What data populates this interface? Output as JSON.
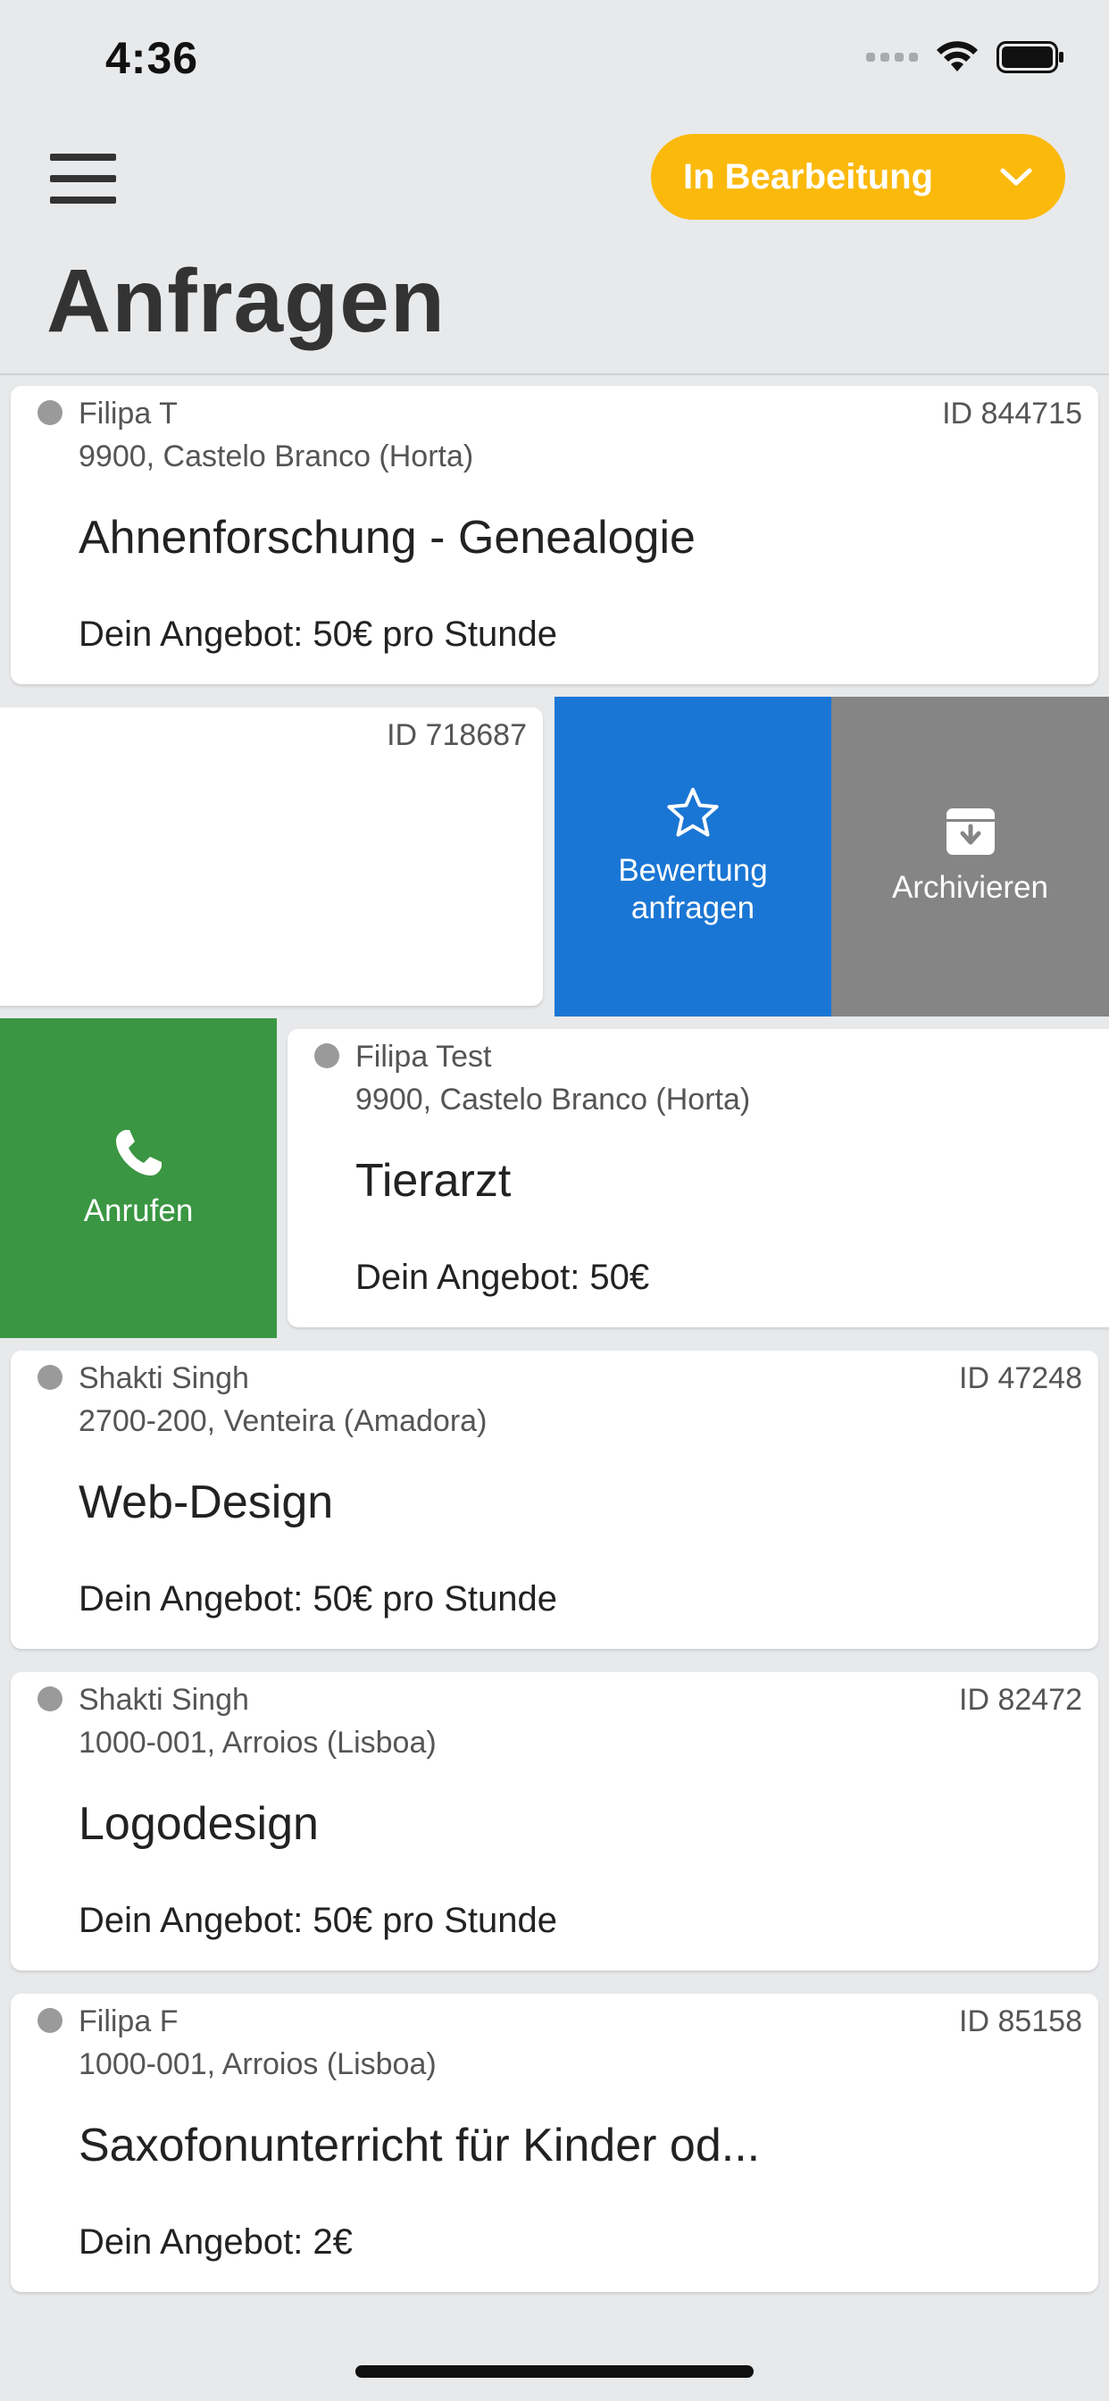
{
  "status_bar": {
    "time": "4:36"
  },
  "header": {
    "filter_label": "In Bearbeitung",
    "title": "Anfragen"
  },
  "requests": [
    {
      "name": "Filipa T",
      "location": "9900, Castelo Branco (Horta)",
      "id": "ID 844715",
      "title": "Ahnenforschung - Genealogie",
      "offer": "Dein Angebot: 50€ pro Stunde"
    },
    {
      "id": "ID 718687"
    },
    {
      "name": "Filipa Test",
      "location": "9900, Castelo Branco (Horta)",
      "title": "Tierarzt",
      "offer": "Dein Angebot: 50€"
    },
    {
      "name": "Shakti Singh",
      "location": "2700-200, Venteira (Amadora)",
      "id": "ID 47248",
      "title": "Web-Design",
      "offer": "Dein Angebot: 50€ pro Stunde"
    },
    {
      "name": "Shakti Singh",
      "location": "1000-001, Arroios (Lisboa)",
      "id": "ID 82472",
      "title": "Logodesign",
      "offer": "Dein Angebot: 50€ pro Stunde"
    },
    {
      "name": "Filipa F",
      "location": "1000-001, Arroios (Lisboa)",
      "id": "ID 85158",
      "title": "Saxofonunterricht für Kinder od...",
      "offer": "Dein Angebot: 2€"
    }
  ],
  "actions": {
    "rate": "Bewertung anfragen",
    "archive": "Archivieren",
    "call": "Anrufen"
  },
  "colors": {
    "accent_yellow": "#fbb90c",
    "rate_blue": "#1a76d4",
    "archive_gray": "#858585",
    "call_green": "#3a9642"
  },
  "icons": [
    "hamburger-menu-icon",
    "chevron-down-icon",
    "star-icon",
    "archive-box-icon",
    "phone-icon",
    "wifi-icon",
    "battery-icon"
  ]
}
